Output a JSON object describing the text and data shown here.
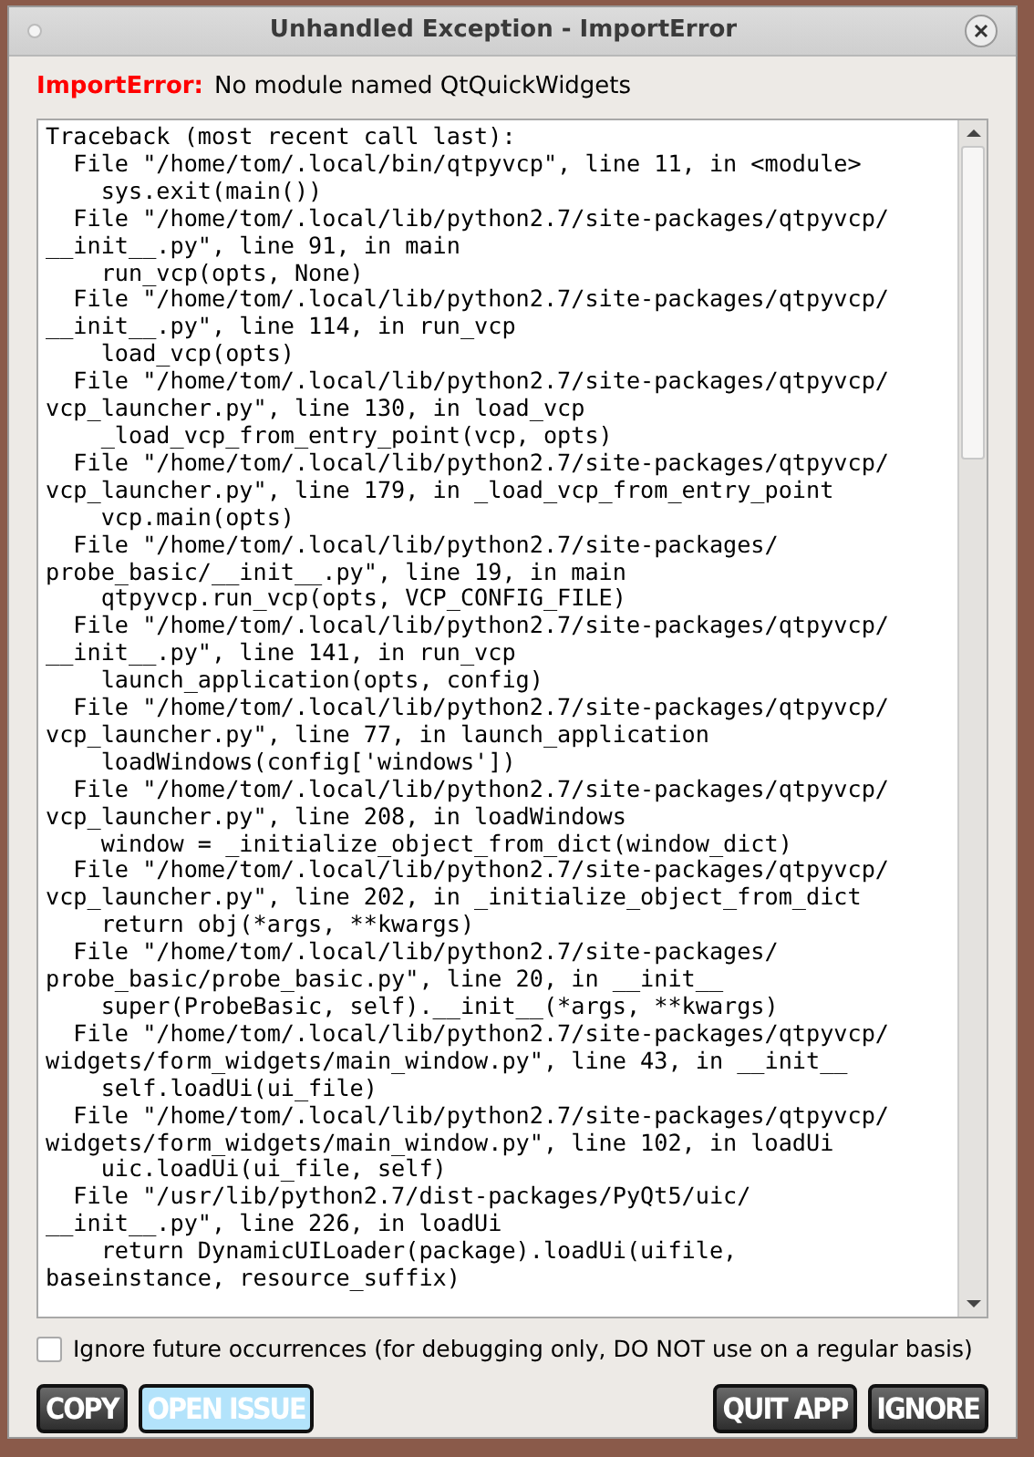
{
  "window": {
    "title": "Unhandled Exception - ImportError"
  },
  "error": {
    "type": "ImportError:",
    "message": "No module named QtQuickWidgets"
  },
  "traceback": [
    "Traceback (most recent call last):",
    "  File \"/home/tom/.local/bin/qtpyvcp\", line 11, in <module>",
    "    sys.exit(main())",
    "  File \"/home/tom/.local/lib/python2.7/site-packages/qtpyvcp/",
    "__init__.py\", line 91, in main",
    "    run_vcp(opts, None)",
    "  File \"/home/tom/.local/lib/python2.7/site-packages/qtpyvcp/",
    "__init__.py\", line 114, in run_vcp",
    "    load_vcp(opts)",
    "  File \"/home/tom/.local/lib/python2.7/site-packages/qtpyvcp/",
    "vcp_launcher.py\", line 130, in load_vcp",
    "    _load_vcp_from_entry_point(vcp, opts)",
    "  File \"/home/tom/.local/lib/python2.7/site-packages/qtpyvcp/",
    "vcp_launcher.py\", line 179, in _load_vcp_from_entry_point",
    "    vcp.main(opts)",
    "  File \"/home/tom/.local/lib/python2.7/site-packages/",
    "probe_basic/__init__.py\", line 19, in main",
    "    qtpyvcp.run_vcp(opts, VCP_CONFIG_FILE)",
    "  File \"/home/tom/.local/lib/python2.7/site-packages/qtpyvcp/",
    "__init__.py\", line 141, in run_vcp",
    "    launch_application(opts, config)",
    "  File \"/home/tom/.local/lib/python2.7/site-packages/qtpyvcp/",
    "vcp_launcher.py\", line 77, in launch_application",
    "    loadWindows(config['windows'])",
    "  File \"/home/tom/.local/lib/python2.7/site-packages/qtpyvcp/",
    "vcp_launcher.py\", line 208, in loadWindows",
    "    window = _initialize_object_from_dict(window_dict)",
    "  File \"/home/tom/.local/lib/python2.7/site-packages/qtpyvcp/",
    "vcp_launcher.py\", line 202, in _initialize_object_from_dict",
    "    return obj(*args, **kwargs)",
    "  File \"/home/tom/.local/lib/python2.7/site-packages/",
    "probe_basic/probe_basic.py\", line 20, in __init__",
    "    super(ProbeBasic, self).__init__(*args, **kwargs)",
    "  File \"/home/tom/.local/lib/python2.7/site-packages/qtpyvcp/",
    "widgets/form_widgets/main_window.py\", line 43, in __init__",
    "    self.loadUi(ui_file)",
    "  File \"/home/tom/.local/lib/python2.7/site-packages/qtpyvcp/",
    "widgets/form_widgets/main_window.py\", line 102, in loadUi",
    "    uic.loadUi(ui_file, self)",
    "  File \"/usr/lib/python2.7/dist-packages/PyQt5/uic/",
    "__init__.py\", line 226, in loadUi",
    "    return DynamicUILoader(package).loadUi(uifile,",
    "baseinstance, resource_suffix)"
  ],
  "ignore_option": {
    "label": "Ignore future occurrences (for debugging only, DO NOT use on a regular basis)",
    "checked": false
  },
  "buttons": [
    {
      "label": "COPY",
      "kind": "dark"
    },
    {
      "label": "OPEN ISSUE",
      "kind": "light"
    },
    {
      "label": "QUIT APP",
      "kind": "dark"
    },
    {
      "label": "IGNORE",
      "kind": "dark"
    }
  ]
}
